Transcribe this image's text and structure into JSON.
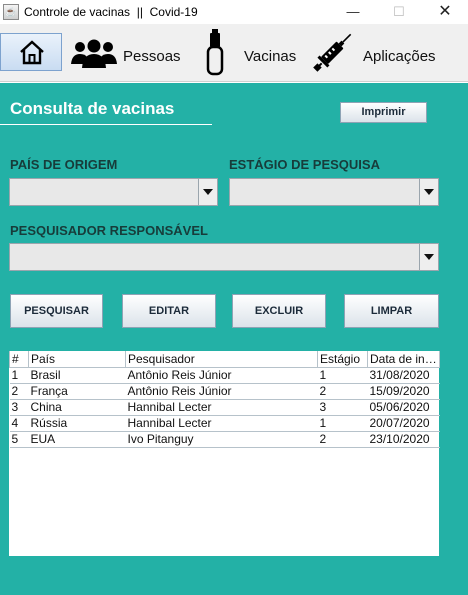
{
  "window": {
    "title": "Controle de vacinas  ||  Covid-19",
    "minimize": "—",
    "maximize": "☐",
    "close": "✕"
  },
  "toolbar": {
    "home_icon": "house-icon",
    "items": [
      {
        "icon": "people-icon",
        "label": "Pessoas"
      },
      {
        "icon": "vial-icon",
        "label": "Vacinas"
      },
      {
        "icon": "syringe-icon",
        "label": "Aplicações"
      }
    ]
  },
  "page": {
    "heading": "Consulta de vacinas",
    "print_label": "Imprimir"
  },
  "filters": {
    "origin_label": "PAÍS DE ORIGEM",
    "origin_value": "",
    "stage_label": "ESTÁGIO DE PESQUISA",
    "stage_value": "",
    "researcher_label": "PESQUISADOR RESPONSÁVEL",
    "researcher_value": ""
  },
  "actions": {
    "search": "PESQUISAR",
    "edit": "EDITAR",
    "delete": "EXCLUIR",
    "clear": "LIMPAR"
  },
  "table": {
    "columns": [
      "#",
      "País",
      "Pesquisador",
      "Estágio",
      "Data de iní..."
    ],
    "rows": [
      [
        "1",
        "Brasil",
        "Antônio Reis Júnior",
        "1",
        "31/08/2020"
      ],
      [
        "2",
        "França",
        "Antônio Reis Júnior",
        "2",
        "15/09/2020"
      ],
      [
        "3",
        "China",
        "Hannibal Lecter",
        "3",
        "05/06/2020"
      ],
      [
        "4",
        "Rússia",
        "Hannibal Lecter",
        "1",
        "20/07/2020"
      ],
      [
        "5",
        "EUA",
        "Ivo Pitanguy",
        "2",
        "23/10/2020"
      ]
    ]
  },
  "colors": {
    "panel_bg": "#23b1a6",
    "label_text": "#173c3a",
    "toolbar_bg": "#f0f0f0"
  }
}
